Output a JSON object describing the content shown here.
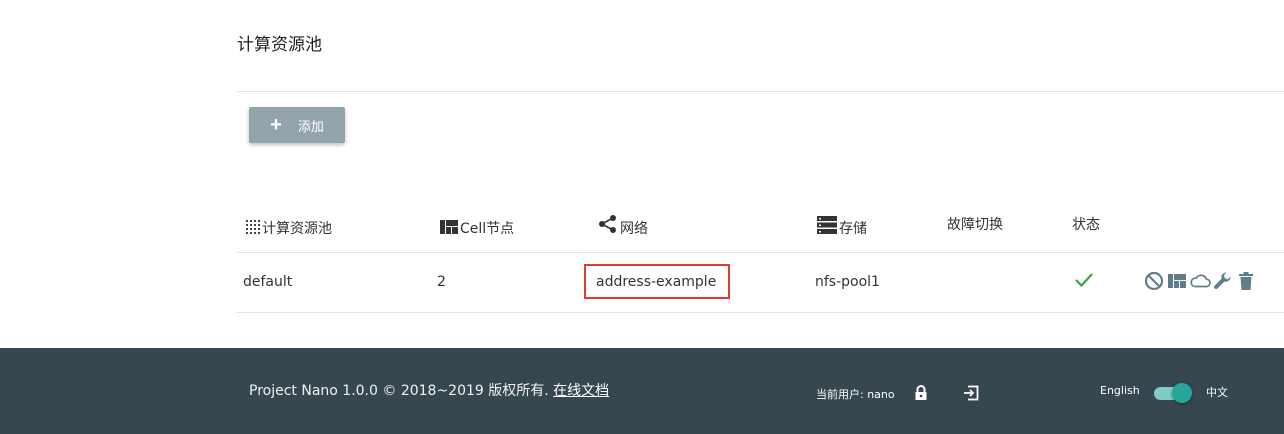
{
  "page": {
    "title": "计算资源池"
  },
  "toolbar": {
    "add_label": "添加"
  },
  "table": {
    "headers": {
      "pool": "计算资源池",
      "cell": "Cell节点",
      "network": "网络",
      "storage": "存储",
      "failover": "故障切换",
      "status": "状态"
    },
    "rows": [
      {
        "pool": "default",
        "cell": "2",
        "network": "address-example",
        "storage": "nfs-pool1",
        "failover": "",
        "status_icon": "check-icon"
      }
    ]
  },
  "actions": [
    "disable-icon",
    "cells-icon",
    "cloud-icon",
    "wrench-icon",
    "trash-icon"
  ],
  "footer": {
    "copyright": "Project Nano 1.0.0 © 2018~2019 版权所有.",
    "docs_link": "在线文档",
    "current_user_label": "当前用户: nano",
    "lang_english": "English",
    "lang_chinese": "中文"
  },
  "colors": {
    "footer_bg": "#37474f",
    "add_button_bg": "#94a4ad",
    "accent": "#26a69a",
    "check": "#43a047",
    "highlight": "#e53935",
    "action_icon": "#607d8b"
  }
}
